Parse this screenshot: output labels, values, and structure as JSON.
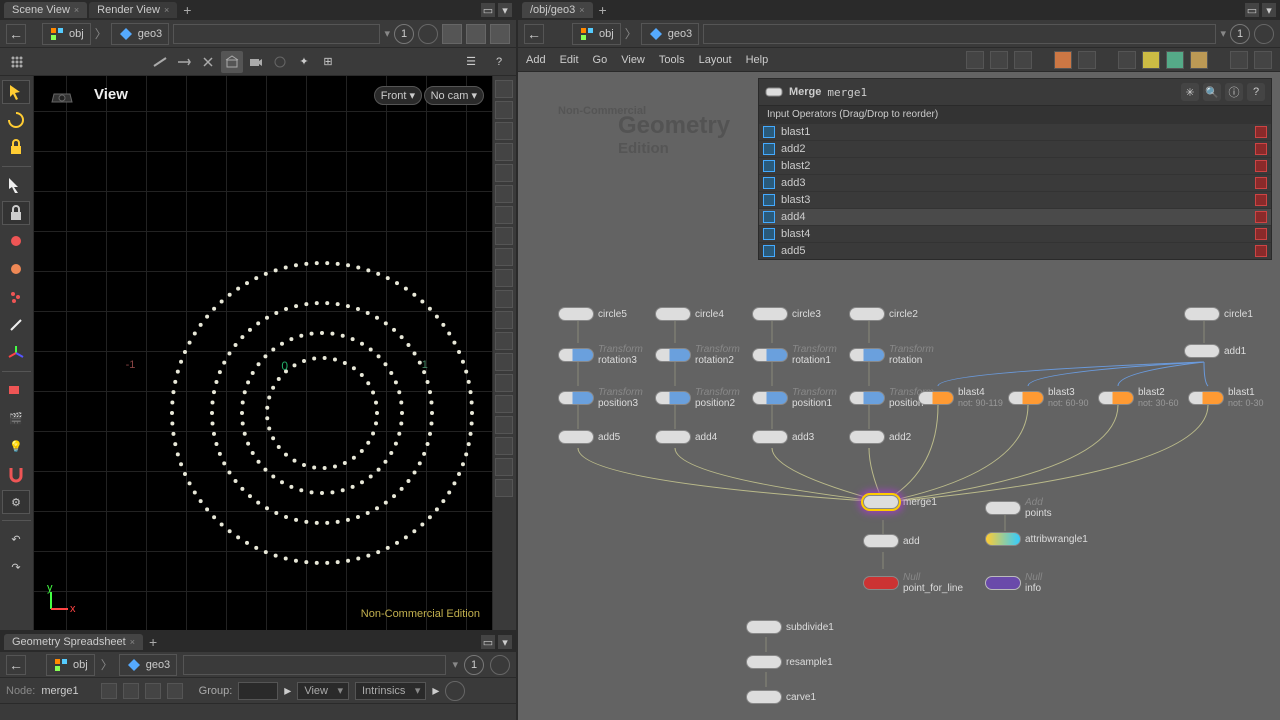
{
  "left": {
    "tabs": [
      "Scene View",
      "Render View"
    ],
    "path": {
      "lv1": "obj",
      "lv2": "geo3"
    },
    "path_num": "1",
    "viewport": {
      "label": "View",
      "dd_view": "Front",
      "dd_cam": "No cam",
      "watermark": "Non-Commercial Edition",
      "origin": "0",
      "tick_left": "-1",
      "tick_right": "1"
    },
    "ss_tab": "Geometry Spreadsheet",
    "ss_path_num": "1",
    "ss_node_label": "Node: ",
    "ss_node_value": "merge1",
    "ss_group_label": "Group:",
    "ss_view_dd": "View",
    "ss_intrinsics": "Intrinsics"
  },
  "right": {
    "tab": "/obj/geo3",
    "path": {
      "lv1": "obj",
      "lv2": "geo3"
    },
    "path_num": "1",
    "menus": [
      "Add",
      "Edit",
      "Go",
      "View",
      "Tools",
      "Layout",
      "Help"
    ],
    "watermark_top": "Non-Commercial",
    "watermark_sub": "Edition",
    "watermark_geo": "Geometry",
    "param": {
      "type": "Merge",
      "name": "merge1",
      "sub": "Input Operators (Drag/Drop to reorder)",
      "rows": [
        "blast1",
        "add2",
        "blast2",
        "add3",
        "blast3",
        "add4",
        "blast4",
        "add5"
      ]
    },
    "nodes": {
      "circle5": "circle5",
      "circle4": "circle4",
      "circle3": "circle3",
      "circle2": "circle2",
      "circle1": "circle1",
      "rotation3": "rotation3",
      "rotation2": "rotation2",
      "rotation1": "rotation1",
      "rotation": "rotation",
      "position3": "position3",
      "position2": "position2",
      "position1": "position1",
      "position": "position",
      "add5": "add5",
      "add4": "add4",
      "add3": "add3",
      "add2": "add2",
      "add1": "add1",
      "merge1": "merge1",
      "add": "add",
      "point_for_line": "point_for_line",
      "blast4": "blast4",
      "blast3": "blast3",
      "blast2": "blast2",
      "blast1": "blast1",
      "blast4_sub": "not: 90-119",
      "blast3_sub": "not: 60-90",
      "blast2_sub": "not: 30-60",
      "blast1_sub": "not: 0-30",
      "points": "points",
      "attribwrangle1": "attribwrangle1",
      "info": "info",
      "subdivide1": "subdivide1",
      "resample1": "resample1",
      "carve1": "carve1",
      "tx": "Transform",
      "addlbl": "Add",
      "nulllbl": "Null"
    }
  }
}
